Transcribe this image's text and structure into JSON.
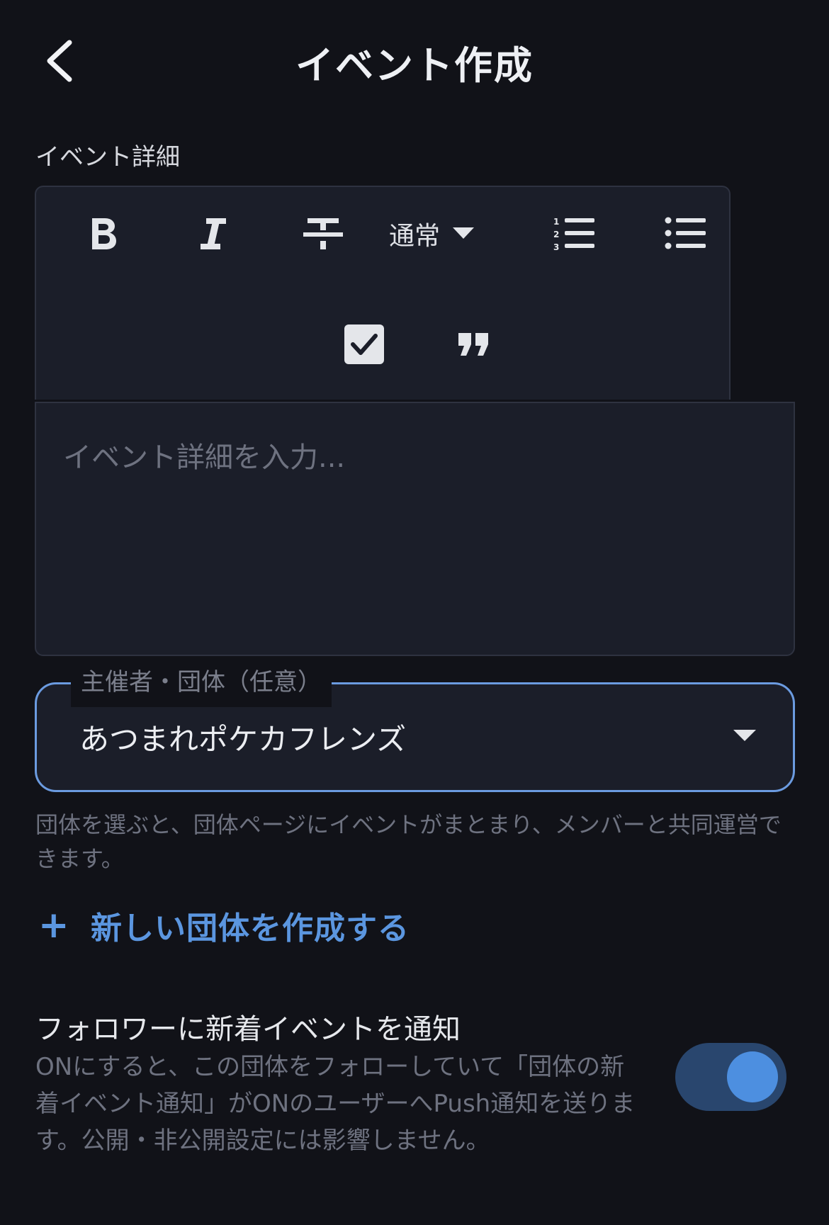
{
  "header": {
    "title": "イベント作成",
    "back_icon": "chevron-left-icon"
  },
  "details": {
    "label": "イベント詳細",
    "toolbar": {
      "format_label": "通常",
      "icons": [
        "bold-icon",
        "italic-icon",
        "strikethrough-icon",
        "chevron-down-icon",
        "ordered-list-icon",
        "bullet-list-icon",
        "checkbox-icon",
        "quote-icon"
      ]
    },
    "editor_placeholder": "イベント詳細を入力..."
  },
  "organizer": {
    "legend": "主催者・団体（任意）",
    "value": "あつまれポケカフレンズ",
    "helper": "団体を選ぶと、団体ページにイベントがまとまり、メンバーと共同運営できます。"
  },
  "create_group": {
    "plus": "+",
    "label": "新しい団体を作成する"
  },
  "notify": {
    "title": "フォロワーに新着イベントを通知",
    "description": "ONにすると、この団体をフォローしていて「団体の新着イベント通知」がONのユーザーへPush通知を送ります。公開・非公開設定には影響しません。",
    "enabled": true
  },
  "colors": {
    "background": "#111218",
    "surface": "#1b1e29",
    "accent": "#5b96e0",
    "toggle_track": "#29466e",
    "toggle_knob": "#4d8fe0"
  }
}
